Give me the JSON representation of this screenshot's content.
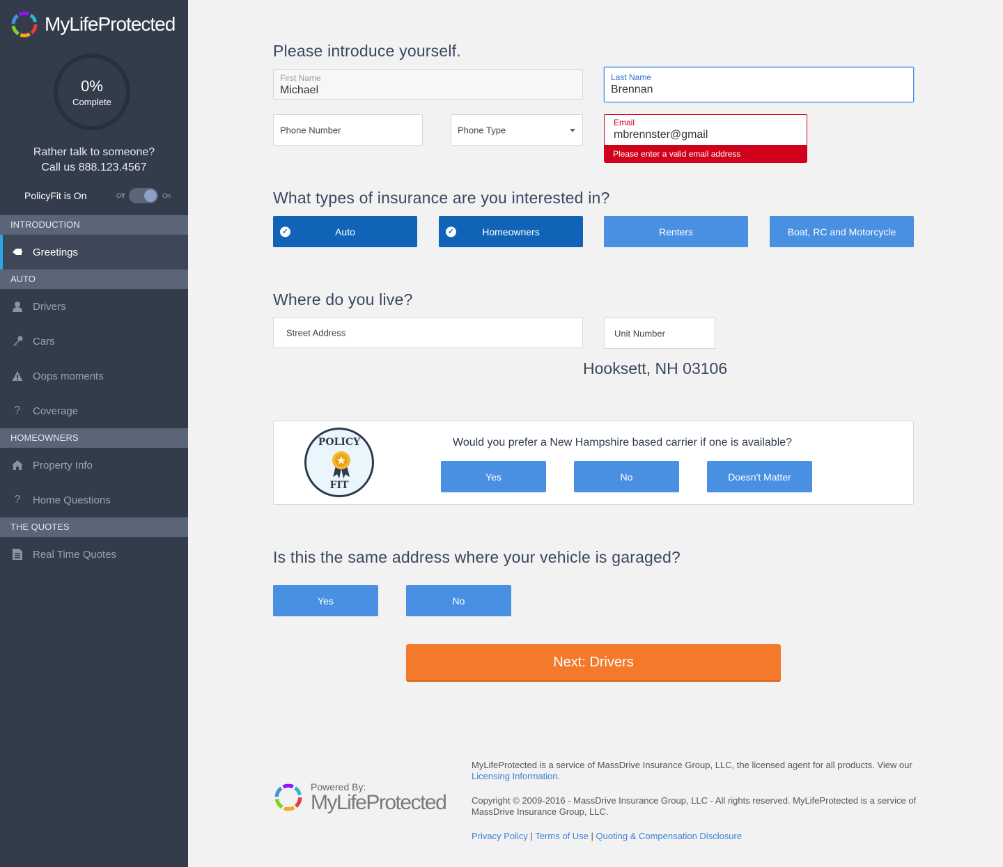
{
  "app": {
    "logo_text": "MyLifeProtected",
    "brand_colors": [
      "#e43d3d",
      "#f5a623",
      "#7ed321",
      "#4a90e2",
      "#9013fe"
    ]
  },
  "sidebar": {
    "progress_value": "0%",
    "progress_label": "Complete",
    "talk_line1": "Rather talk to someone?",
    "talk_line2": "Call us 888.123.4567",
    "policyfit_label": "PolicyFit is On",
    "toggle_off": "Off",
    "toggle_on": "On",
    "toggle_state": true,
    "sections": [
      {
        "title": "INTRODUCTION",
        "items": [
          {
            "label": "Greetings",
            "icon": "hand-icon",
            "active": true
          }
        ]
      },
      {
        "title": "AUTO",
        "items": [
          {
            "label": "Drivers",
            "icon": "person-icon"
          },
          {
            "label": "Cars",
            "icon": "key-icon"
          },
          {
            "label": "Oops moments",
            "icon": "warning-icon"
          },
          {
            "label": "Coverage",
            "icon": "question-icon"
          }
        ]
      },
      {
        "title": "HOMEOWNERS",
        "items": [
          {
            "label": "Property Info",
            "icon": "house-icon"
          },
          {
            "label": "Home Questions",
            "icon": "question-icon"
          }
        ]
      },
      {
        "title": "THE QUOTES",
        "items": [
          {
            "label": "Real Time Quotes",
            "icon": "document-icon"
          }
        ]
      }
    ]
  },
  "intro": {
    "heading": "Please introduce yourself.",
    "first_name_label": "First Name",
    "first_name_value": "Michael",
    "last_name_label": "Last Name",
    "last_name_value": "Brennan",
    "phone_placeholder": "Phone Number",
    "phone_type_placeholder": "Phone Type",
    "email_label": "Email",
    "email_value": "mbrennster@gmail",
    "email_error": "Please enter a valid email address"
  },
  "insurance": {
    "heading": "What types of insurance are you interested in?",
    "options": [
      {
        "label": "Auto",
        "selected": true
      },
      {
        "label": "Homeowners",
        "selected": true
      },
      {
        "label": "Renters",
        "selected": false
      },
      {
        "label": "Boat, RC and Motorcycle",
        "selected": false
      }
    ]
  },
  "address": {
    "heading": "Where do you live?",
    "street_placeholder": "Street Address",
    "unit_placeholder": "Unit Number",
    "city_line": "Hooksett, NH 03106"
  },
  "policyfit": {
    "badge_top": "POLICY",
    "badge_bottom": "FIT",
    "question": "Would you prefer a New Hampshire based carrier if one is available?",
    "options": [
      "Yes",
      "No",
      "Doesn't Matter"
    ]
  },
  "garage": {
    "heading": "Is this the same address where your vehicle is garaged?",
    "yes": "Yes",
    "no": "No"
  },
  "next_button": "Next: Drivers",
  "footer": {
    "powered_by": "Powered By:",
    "powered_name": "MyLifeProtected",
    "line1": "MyLifeProtected is a service of MassDrive Insurance Group, LLC, the licensed agent for all products. View our",
    "licensing_link": "Licensing Information",
    "line1_end": ".",
    "copyright": "Copyright © 2009-2016 - MassDrive Insurance Group, LLC - All rights reserved. MyLifeProtected is a service of MassDrive Insurance Group, LLC.",
    "links": [
      "Privacy Policy",
      "Terms of Use",
      "Quoting & Compensation Disclosure"
    ]
  }
}
